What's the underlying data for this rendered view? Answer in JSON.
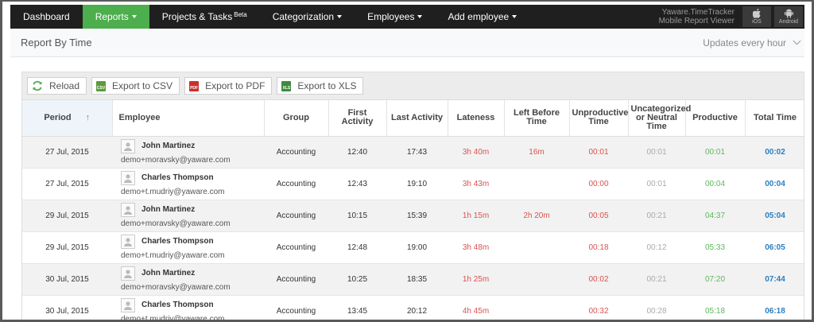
{
  "nav": {
    "items": [
      {
        "label": "Dashboard",
        "active": false,
        "caret": false
      },
      {
        "label": "Reports",
        "active": true,
        "caret": true
      },
      {
        "label": "Projects & Tasks",
        "sup": "Beta",
        "active": false,
        "caret": false
      },
      {
        "label": "Categorization",
        "active": false,
        "caret": true
      },
      {
        "label": "Employees",
        "active": false,
        "caret": true
      },
      {
        "label": "Add employee",
        "active": false,
        "caret": true
      }
    ],
    "mobile_line1": "Yaware.TimeTracker",
    "mobile_line2": "Mobile Report Viewer",
    "ios_label": "iOS",
    "android_label": "Android"
  },
  "header": {
    "title": "Report By Time",
    "updates": "Updates every hour"
  },
  "toolbar": {
    "reload": "Reload",
    "csv": "Export to CSV",
    "pdf": "Export to PDF",
    "xls": "Export to XLS",
    "csv_tag": "CSV",
    "pdf_tag": "PDF",
    "xls_tag": "XLS"
  },
  "columns": [
    "Period",
    "Employee",
    "Group",
    "First Activity",
    "Last Activity",
    "Lateness",
    "Left Before Time",
    "Unproductive Time",
    "Uncategorized or Neutral Time",
    "Productive",
    "Total Time"
  ],
  "rows": [
    {
      "period": "27 Jul, 2015",
      "name": "John Martinez",
      "email": "demo+moravsky@yaware.com",
      "group": "Accounting",
      "first": "12:40",
      "last": "17:43",
      "late": "3h 40m",
      "left": "16m",
      "unprod": "00:01",
      "neutral": "00:01",
      "prod": "00:01",
      "total": "00:02"
    },
    {
      "period": "27 Jul, 2015",
      "name": "Charles Thompson",
      "email": "demo+t.mudriy@yaware.com",
      "group": "Accounting",
      "first": "12:43",
      "last": "19:10",
      "late": "3h 43m",
      "left": "",
      "unprod": "00:00",
      "neutral": "00:01",
      "prod": "00:04",
      "total": "00:04"
    },
    {
      "period": "29 Jul, 2015",
      "name": "John Martinez",
      "email": "demo+moravsky@yaware.com",
      "group": "Accounting",
      "first": "10:15",
      "last": "15:39",
      "late": "1h 15m",
      "left": "2h 20m",
      "unprod": "00:05",
      "neutral": "00:21",
      "prod": "04:37",
      "total": "05:04"
    },
    {
      "period": "29 Jul, 2015",
      "name": "Charles Thompson",
      "email": "demo+t.mudriy@yaware.com",
      "group": "Accounting",
      "first": "12:48",
      "last": "19:00",
      "late": "3h 48m",
      "left": "",
      "unprod": "00:18",
      "neutral": "00:12",
      "prod": "05:33",
      "total": "06:05"
    },
    {
      "period": "30 Jul, 2015",
      "name": "John Martinez",
      "email": "demo+moravsky@yaware.com",
      "group": "Accounting",
      "first": "10:25",
      "last": "18:35",
      "late": "1h 25m",
      "left": "",
      "unprod": "00:02",
      "neutral": "00:21",
      "prod": "07:20",
      "total": "07:44"
    },
    {
      "period": "30 Jul, 2015",
      "name": "Charles Thompson",
      "email": "demo+t.mudriy@yaware.com",
      "group": "Accounting",
      "first": "13:45",
      "last": "20:12",
      "late": "4h 45m",
      "left": "",
      "unprod": "00:32",
      "neutral": "00:28",
      "prod": "05:18",
      "total": "06:18"
    }
  ],
  "colors": {
    "nav_bg": "#1f1f1f",
    "active": "#4cae4c",
    "lateness": "#d9534f",
    "productive": "#5cb85c",
    "total": "#2a7fc1"
  }
}
